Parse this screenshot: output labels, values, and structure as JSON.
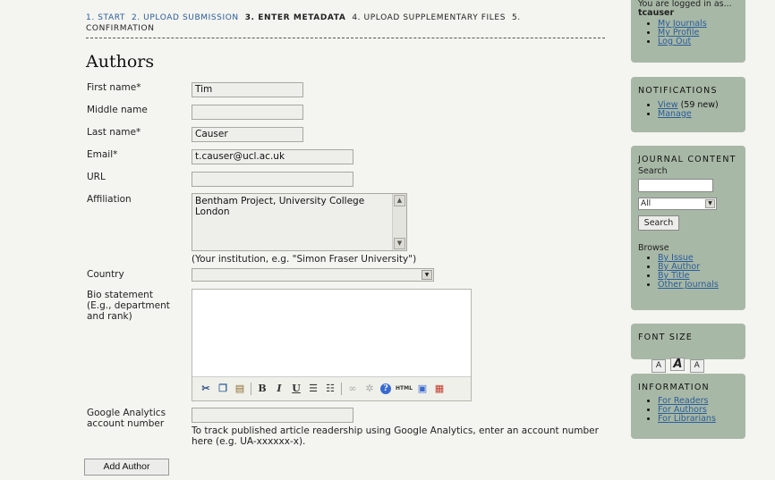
{
  "steps": {
    "step1": "1. START",
    "step2": "2. UPLOAD SUBMISSION",
    "step3": "3. ENTER METADATA",
    "step4": "4. UPLOAD SUPPLEMENTARY FILES",
    "step5": "5.",
    "step5_cont": "CONFIRMATION"
  },
  "section_title": "Authors",
  "form": {
    "first_name_label": "First name*",
    "first_name_value": "Tim",
    "middle_name_label": "Middle name",
    "middle_name_value": "",
    "last_name_label": "Last name*",
    "last_name_value": "Causer",
    "email_label": "Email*",
    "email_value": "t.causer@ucl.ac.uk",
    "url_label": "URL",
    "url_value": "",
    "affiliation_label": "Affiliation",
    "affiliation_value": "Bentham Project, University College London",
    "affiliation_hint": "(Your institution, e.g. \"Simon Fraser University\")",
    "country_label": "Country",
    "country_value": "",
    "bio_label_1": "Bio statement",
    "bio_label_2": "(E.g., department",
    "bio_label_3": "and rank)",
    "ga_label_1": "Google Analytics",
    "ga_label_2": "account number",
    "ga_value": "",
    "ga_hint_1": "To track published article readership using Google Analytics, enter an account number",
    "ga_hint_2": "here (e.g. UA-xxxxxx-x).",
    "add_author_button": "Add Author"
  },
  "editor_toolbar": [
    "cut-icon",
    "copy-icon",
    "paste-icon",
    "bold-icon",
    "italic-icon",
    "underline-icon",
    "bullet-list-icon",
    "numbered-list-icon",
    "link-icon",
    "unlink-icon",
    "help-icon",
    "html-icon",
    "fullscreen-icon",
    "paste-word-icon"
  ],
  "sidebar": {
    "user": {
      "logged_in_text": "You are logged in as...",
      "username": "tcauser",
      "links": [
        "My Journals",
        "My Profile",
        "Log Out"
      ]
    },
    "notifications": {
      "title": "NOTIFICATIONS",
      "view_link": "View",
      "view_count": "(59 new)",
      "manage_link": "Manage"
    },
    "journal_content": {
      "title": "JOURNAL CONTENT",
      "search_label": "Search",
      "search_scope": "All",
      "search_button": "Search",
      "browse_label": "Browse",
      "browse_links": [
        "By Issue",
        "By Author",
        "By Title",
        "Other Journals"
      ]
    },
    "font_size": {
      "title": "FONT SIZE",
      "small": "A",
      "medium": "A",
      "large": "A"
    },
    "information": {
      "title": "INFORMATION",
      "links": [
        "For Readers",
        "For Authors",
        "For Librarians"
      ]
    }
  },
  "colors": {
    "page_bg": "#f4f4f0",
    "sidebar_bg": "#a8b8a6",
    "link": "#2a5d9a"
  }
}
